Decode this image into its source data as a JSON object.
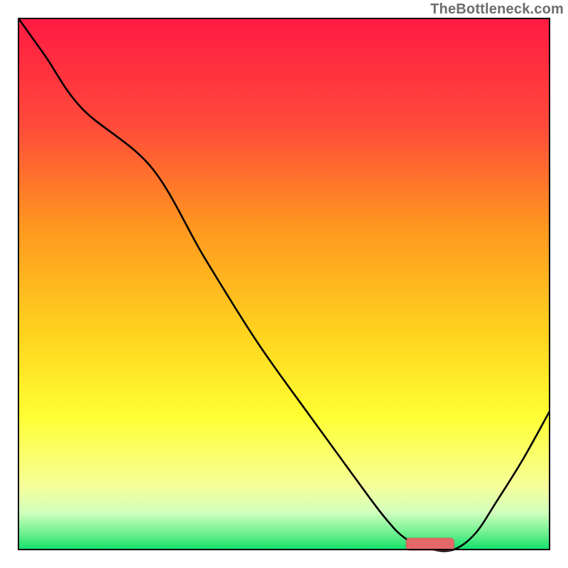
{
  "watermark": "TheBottleneck.com",
  "colors": {
    "gradient_stops": [
      {
        "offset": 0.0,
        "color": "#ff1a43"
      },
      {
        "offset": 0.2,
        "color": "#ff4a3a"
      },
      {
        "offset": 0.4,
        "color": "#ff9a1f"
      },
      {
        "offset": 0.6,
        "color": "#ffd51f"
      },
      {
        "offset": 0.75,
        "color": "#ffff33"
      },
      {
        "offset": 0.88,
        "color": "#f6ff99"
      },
      {
        "offset": 0.93,
        "color": "#d2ffbe"
      },
      {
        "offset": 0.97,
        "color": "#6cf08f"
      },
      {
        "offset": 1.0,
        "color": "#11e06a"
      }
    ],
    "curve": "#000000",
    "marker_fill": "#e46868",
    "marker_stroke": "#cc5a5a",
    "frame": "#000000",
    "background": "#ffffff"
  },
  "chart_data": {
    "type": "line",
    "title": "",
    "xlabel": "",
    "ylabel": "",
    "xlim": [
      0,
      100
    ],
    "ylim": [
      0,
      100
    ],
    "series": [
      {
        "name": "bottleneck-curve",
        "x": [
          0,
          5,
          12,
          25,
          35,
          45,
          55,
          63,
          69,
          73,
          78,
          82,
          86,
          90,
          95,
          100
        ],
        "values": [
          100,
          93,
          83,
          72,
          55,
          39,
          25,
          14,
          6,
          2,
          0,
          0,
          3,
          9,
          17,
          26
        ]
      }
    ],
    "marker": {
      "x_start": 73,
      "x_end": 82,
      "y": 0,
      "height": 2
    }
  }
}
